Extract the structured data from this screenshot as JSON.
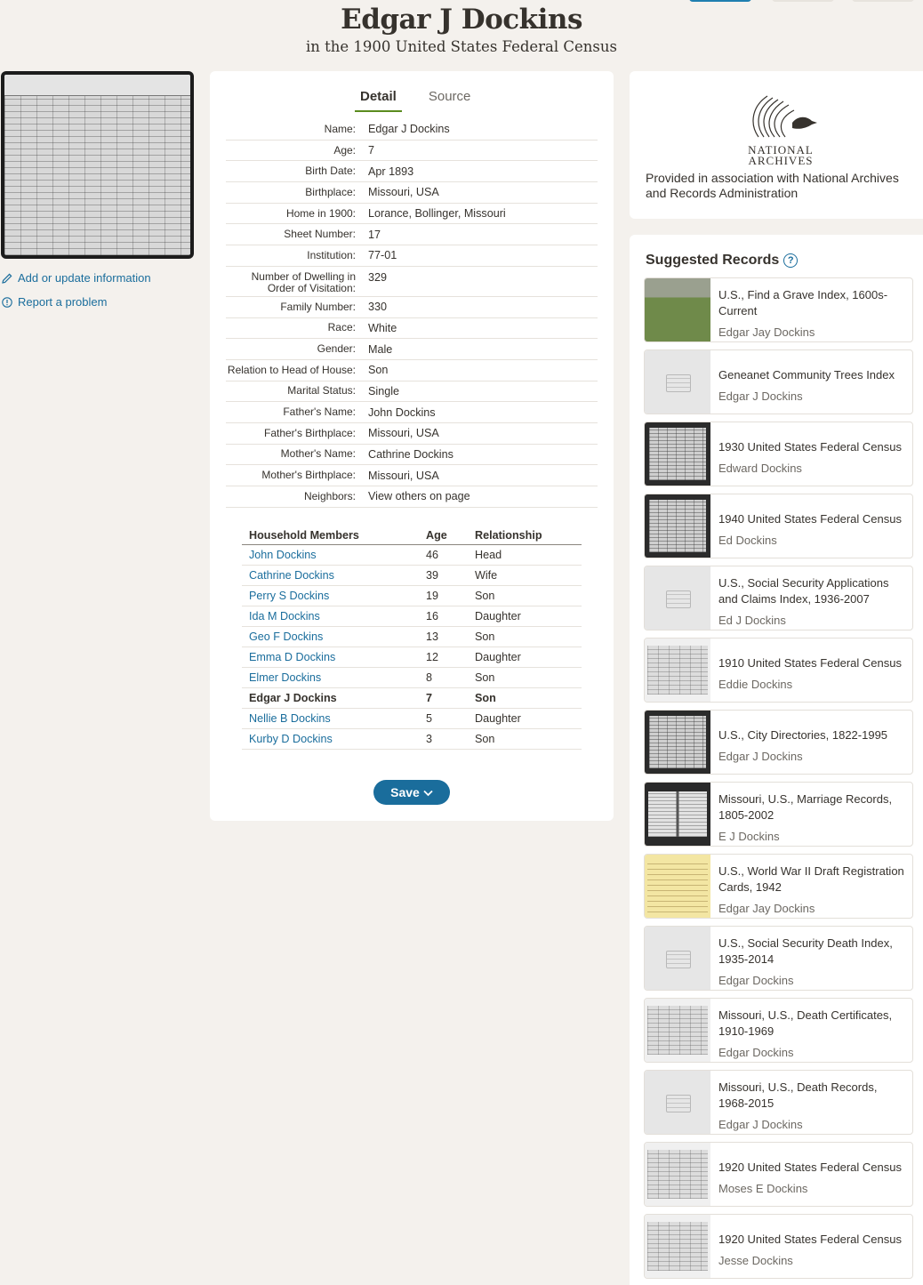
{
  "header": {
    "title": "Edgar J Dockins",
    "subtitle": "in the 1900 United States Federal Census"
  },
  "sidebar": {
    "add_info": "Add or update information",
    "report": "Report a problem"
  },
  "tabs": {
    "detail": "Detail",
    "source": "Source"
  },
  "facts": [
    {
      "label": "Name:",
      "value": "Edgar J Dockins"
    },
    {
      "label": "Age:",
      "value": "7"
    },
    {
      "label": "Birth Date:",
      "value": "Apr 1893"
    },
    {
      "label": "Birthplace:",
      "value": "Missouri, USA"
    },
    {
      "label": "Home in 1900:",
      "value": "Lorance, Bollinger, Missouri"
    },
    {
      "label": "Sheet Number:",
      "value": "17"
    },
    {
      "label": "Institution:",
      "value": "77-01"
    },
    {
      "label": "Number of Dwelling in Order of Visitation:",
      "value": "329"
    },
    {
      "label": "Family Number:",
      "value": "330"
    },
    {
      "label": "Race:",
      "value": "White"
    },
    {
      "label": "Gender:",
      "value": "Male"
    },
    {
      "label": "Relation to Head of House:",
      "value": "Son"
    },
    {
      "label": "Marital Status:",
      "value": "Single"
    },
    {
      "label": "Father's Name:",
      "value": "John Dockins"
    },
    {
      "label": "Father's Birthplace:",
      "value": "Missouri, USA"
    },
    {
      "label": "Mother's Name:",
      "value": "Cathrine Dockins"
    },
    {
      "label": "Mother's Birthplace:",
      "value": "Missouri, USA"
    },
    {
      "label": "Neighbors:",
      "value": "View others on page"
    }
  ],
  "household": {
    "headers": [
      "Household Members",
      "Age",
      "Relationship"
    ],
    "rows": [
      {
        "name": "John Dockins",
        "age": "46",
        "rel": "Head"
      },
      {
        "name": "Cathrine Dockins",
        "age": "39",
        "rel": "Wife"
      },
      {
        "name": "Perry S Dockins",
        "age": "19",
        "rel": "Son"
      },
      {
        "name": "Ida M Dockins",
        "age": "16",
        "rel": "Daughter"
      },
      {
        "name": "Geo F Dockins",
        "age": "13",
        "rel": "Son"
      },
      {
        "name": "Emma D Dockins",
        "age": "12",
        "rel": "Daughter"
      },
      {
        "name": "Elmer Dockins",
        "age": "8",
        "rel": "Son"
      },
      {
        "name": "Edgar J Dockins",
        "age": "7",
        "rel": "Son"
      },
      {
        "name": "Nellie B Dockins",
        "age": "5",
        "rel": "Daughter"
      },
      {
        "name": "Kurby D Dockins",
        "age": "3",
        "rel": "Son"
      }
    ]
  },
  "save_label": "Save",
  "archives": {
    "logo_line1": "NATIONAL",
    "logo_line2": "ARCHIVES",
    "text": "Provided in association with National Archives and Records Administration"
  },
  "suggested": {
    "title": "Suggested Records",
    "records": [
      {
        "title": "U.S., Find a Grave Index, 1600s-Current",
        "name": "Edgar Jay Dockins",
        "thumb": "grave"
      },
      {
        "title": "Geneanet Community Trees Index",
        "name": "Edgar J Dockins",
        "thumb": "placeholder"
      },
      {
        "title": "1930 United States Federal Census",
        "name": "Edward Dockins",
        "thumb": "doc"
      },
      {
        "title": "1940 United States Federal Census",
        "name": "Ed Dockins",
        "thumb": "doc"
      },
      {
        "title": "U.S., Social Security Applications and Claims Index, 1936-2007",
        "name": "Ed J Dockins",
        "thumb": "placeholder"
      },
      {
        "title": "1910 United States Federal Census",
        "name": "Eddie Dockins",
        "thumb": "light"
      },
      {
        "title": "U.S., City Directories, 1822-1995",
        "name": "Edgar J Dockins",
        "thumb": "doc"
      },
      {
        "title": "Missouri, U.S., Marriage Records, 1805-2002",
        "name": "E J Dockins",
        "thumb": "book"
      },
      {
        "title": "U.S., World War II Draft Registration Cards, 1942",
        "name": "Edgar Jay Dockins",
        "thumb": "yellow"
      },
      {
        "title": "U.S., Social Security Death Index, 1935-2014",
        "name": "Edgar Dockins",
        "thumb": "placeholder"
      },
      {
        "title": "Missouri, U.S., Death Certificates, 1910-1969",
        "name": "Edgar Dockins",
        "thumb": "light"
      },
      {
        "title": "Missouri, U.S., Death Records, 1968-2015",
        "name": "Edgar J Dockins",
        "thumb": "placeholder"
      },
      {
        "title": "1920 United States Federal Census",
        "name": "Moses E Dockins",
        "thumb": "light"
      },
      {
        "title": "1920 United States Federal Census",
        "name": "Jesse Dockins",
        "thumb": "light"
      }
    ]
  },
  "icons": {
    "add_info_icon": "pencil-icon",
    "report_icon": "info-circle-icon",
    "save_icon": "chevron-down-icon",
    "help_icon": "question-circle-icon"
  },
  "colors": {
    "link": "#1a6d9c",
    "tab_active": "#5b8c1f",
    "background": "#f4f1ed"
  }
}
